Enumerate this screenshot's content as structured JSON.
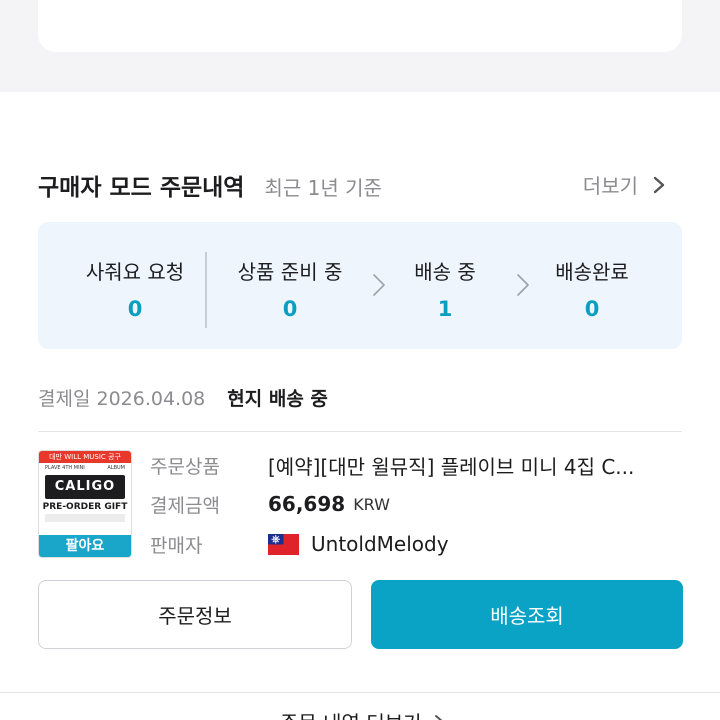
{
  "header": {
    "title": "구매자 모드 주문내역",
    "subtitle": "최근 1년 기준",
    "more_label": "더보기"
  },
  "statuses": [
    {
      "label": "사줘요 요청",
      "count": "0"
    },
    {
      "label": "상품 준비 중",
      "count": "0"
    },
    {
      "label": "배송 중",
      "count": "1"
    },
    {
      "label": "배송완료",
      "count": "0"
    }
  ],
  "order": {
    "payment_date": "결제일 2026.04.08",
    "status": "현지 배송 중",
    "thumbnail": {
      "top_text": "대만 WILL MUSIC 공구",
      "sub_left": "PLAVE 4TH MINI",
      "sub_right": "ALBUM",
      "logo_text": "CALIGO",
      "gift_text": "PRE-ORDER GIFT",
      "badge": "팔아요"
    },
    "fields": {
      "product_label": "주문상품",
      "product_value": "[예약][대만 윌뮤직] 플레이브 미니 4집 C...",
      "amount_label": "결제금액",
      "amount_value": "66,698",
      "currency": "KRW",
      "seller_label": "판매자",
      "seller_value": "UntoldMelody",
      "seller_flag_icon": "taiwan-flag-icon"
    }
  },
  "buttons": {
    "order_info": "주문정보",
    "track_shipping": "배송조회"
  },
  "footer": {
    "more_orders": "주문 내역 더보기"
  },
  "colors": {
    "accent": "#0ba3c5",
    "status_bg": "#eef5fd",
    "count_color": "#0a9fc1"
  }
}
